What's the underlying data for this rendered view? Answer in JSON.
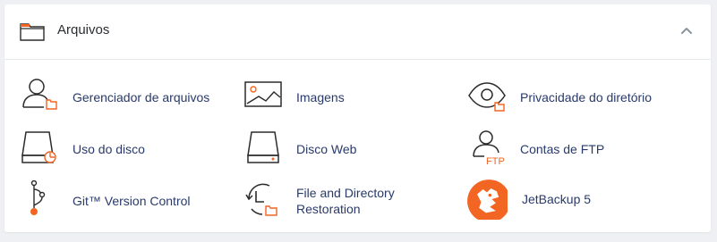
{
  "section": {
    "title": "Arquivos",
    "colors": {
      "accent": "#f26522",
      "icon_stroke": "#2b2b2b",
      "link_text": "#293a6a"
    }
  },
  "items": [
    {
      "label": "Gerenciador de arquivos",
      "icon": "file-manager-icon"
    },
    {
      "label": "Imagens",
      "icon": "images-icon"
    },
    {
      "label": "Privacidade do diretório",
      "icon": "directory-privacy-icon"
    },
    {
      "label": "Uso do disco",
      "icon": "disk-usage-icon"
    },
    {
      "label": "Disco Web",
      "icon": "web-disk-icon"
    },
    {
      "label": "Contas de FTP",
      "icon": "ftp-accounts-icon",
      "icon_text": "FTP"
    },
    {
      "label": "Git™ Version Control",
      "icon": "git-version-control-icon"
    },
    {
      "label": "File and Directory Restoration",
      "icon": "file-restoration-icon"
    },
    {
      "label": "JetBackup 5",
      "icon": "jetbackup-icon"
    }
  ]
}
